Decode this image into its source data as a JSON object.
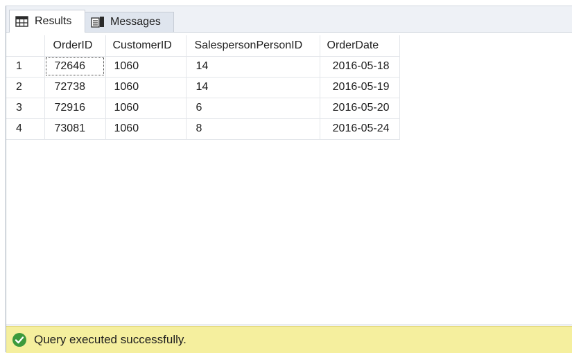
{
  "tabs": [
    {
      "label": "Results",
      "icon": "grid-icon",
      "active": true
    },
    {
      "label": "Messages",
      "icon": "messages-icon",
      "active": false
    }
  ],
  "grid": {
    "columns": [
      "",
      "OrderID",
      "CustomerID",
      "SalespersonPersonID",
      "OrderDate"
    ],
    "rows": [
      {
        "num": "1",
        "order_id": "72646",
        "customer_id": "1060",
        "salesperson_id": "14",
        "order_date": "2016-05-18"
      },
      {
        "num": "2",
        "order_id": "72738",
        "customer_id": "1060",
        "salesperson_id": "14",
        "order_date": "2016-05-19"
      },
      {
        "num": "3",
        "order_id": "72916",
        "customer_id": "1060",
        "salesperson_id": "6",
        "order_date": "2016-05-20"
      },
      {
        "num": "4",
        "order_id": "73081",
        "customer_id": "1060",
        "salesperson_id": "8",
        "order_date": "2016-05-24"
      }
    ]
  },
  "status": {
    "text": "Query executed successfully.",
    "icon": "check-circle-icon",
    "icon_color": "#3c9a3c",
    "background": "#f5ef9e"
  }
}
